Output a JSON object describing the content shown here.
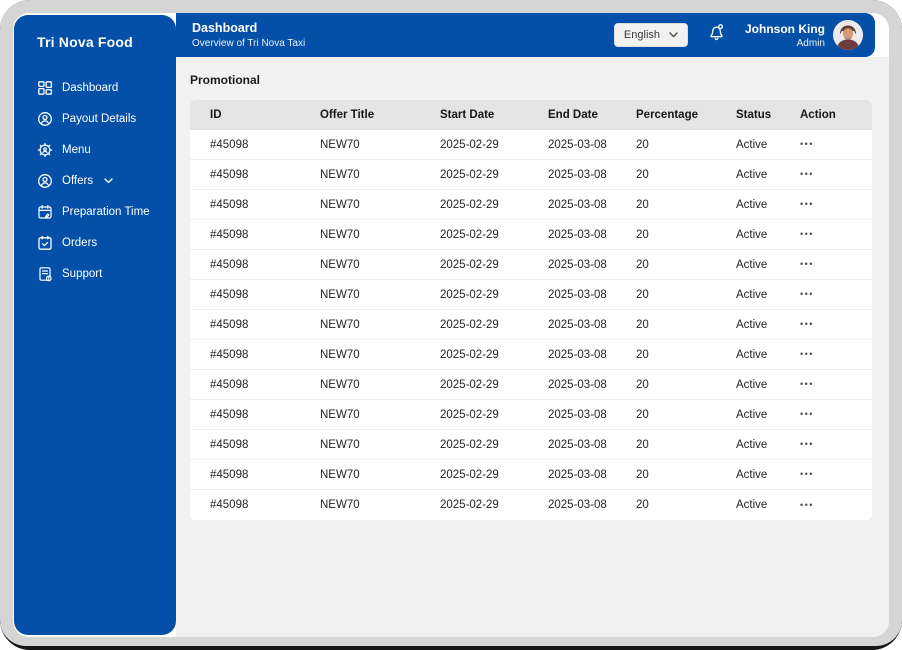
{
  "colors": {
    "brand_blue": "#0450a8",
    "frame_gray": "#d5d5d5",
    "content_bg": "#f1f1f2",
    "table_header_bg": "#e4e4e5"
  },
  "sidebar": {
    "title": "Tri Nova Food",
    "items": [
      {
        "label": "Dashboard",
        "icon": "dashboard-icon"
      },
      {
        "label": "Payout Details",
        "icon": "user-circle-icon"
      },
      {
        "label": "Menu",
        "icon": "gear-user-icon"
      },
      {
        "label": "Offers",
        "icon": "user-circle-icon",
        "has_submenu": true
      },
      {
        "label": "Preparation Time",
        "icon": "calendar-edit-icon"
      },
      {
        "label": "Orders",
        "icon": "calendar-check-icon"
      },
      {
        "label": "Support",
        "icon": "support-doc-icon"
      }
    ]
  },
  "header": {
    "title": "Dashboard",
    "subtitle": "Overview of Tri Nova Taxi",
    "language_selector": {
      "value": "English",
      "icon": "chevron-down-icon"
    },
    "notifications": {
      "icon": "bell-icon"
    },
    "user": {
      "name": "Johnson King",
      "role": "Admin"
    }
  },
  "main": {
    "section_title": "Promotional",
    "table": {
      "columns": [
        "ID",
        "Offer Title",
        "Start Date",
        "End Date",
        "Percentage",
        "Status",
        "Action"
      ],
      "action_label": "•••",
      "rows": [
        {
          "id": "#45098",
          "offer_title": "NEW70",
          "start_date": "2025-02-29",
          "end_date": "2025-03-08",
          "percentage": "20",
          "status": "Active"
        },
        {
          "id": "#45098",
          "offer_title": "NEW70",
          "start_date": "2025-02-29",
          "end_date": "2025-03-08",
          "percentage": "20",
          "status": "Active"
        },
        {
          "id": "#45098",
          "offer_title": "NEW70",
          "start_date": "2025-02-29",
          "end_date": "2025-03-08",
          "percentage": "20",
          "status": "Active"
        },
        {
          "id": "#45098",
          "offer_title": "NEW70",
          "start_date": "2025-02-29",
          "end_date": "2025-03-08",
          "percentage": "20",
          "status": "Active"
        },
        {
          "id": "#45098",
          "offer_title": "NEW70",
          "start_date": "2025-02-29",
          "end_date": "2025-03-08",
          "percentage": "20",
          "status": "Active"
        },
        {
          "id": "#45098",
          "offer_title": "NEW70",
          "start_date": "2025-02-29",
          "end_date": "2025-03-08",
          "percentage": "20",
          "status": "Active"
        },
        {
          "id": "#45098",
          "offer_title": "NEW70",
          "start_date": "2025-02-29",
          "end_date": "2025-03-08",
          "percentage": "20",
          "status": "Active"
        },
        {
          "id": "#45098",
          "offer_title": "NEW70",
          "start_date": "2025-02-29",
          "end_date": "2025-03-08",
          "percentage": "20",
          "status": "Active"
        },
        {
          "id": "#45098",
          "offer_title": "NEW70",
          "start_date": "2025-02-29",
          "end_date": "2025-03-08",
          "percentage": "20",
          "status": "Active"
        },
        {
          "id": "#45098",
          "offer_title": "NEW70",
          "start_date": "2025-02-29",
          "end_date": "2025-03-08",
          "percentage": "20",
          "status": "Active"
        },
        {
          "id": "#45098",
          "offer_title": "NEW70",
          "start_date": "2025-02-29",
          "end_date": "2025-03-08",
          "percentage": "20",
          "status": "Active"
        },
        {
          "id": "#45098",
          "offer_title": "NEW70",
          "start_date": "2025-02-29",
          "end_date": "2025-03-08",
          "percentage": "20",
          "status": "Active"
        },
        {
          "id": "#45098",
          "offer_title": "NEW70",
          "start_date": "2025-02-29",
          "end_date": "2025-03-08",
          "percentage": "20",
          "status": "Active"
        }
      ]
    }
  }
}
